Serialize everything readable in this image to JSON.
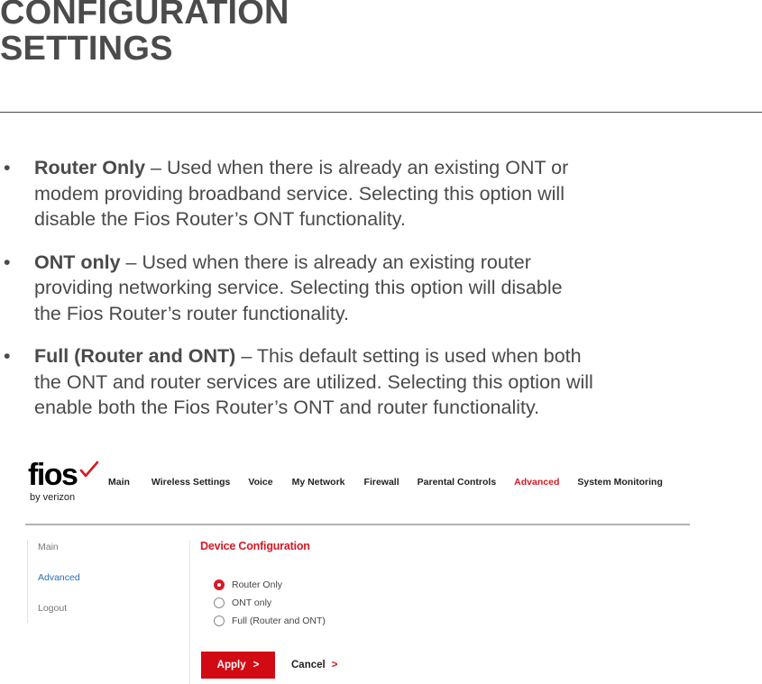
{
  "document": {
    "title_lines": [
      "CONFIGURATION",
      "SETTINGS"
    ],
    "bullet_glyph": "•",
    "bullets": [
      {
        "term": "Router Only",
        "lines": [
          " – Used when there is already an existing ONT or",
          "modem providing broadband service. Selecting this option will",
          "disable the Fios Router’s ONT functionality."
        ]
      },
      {
        "term": "ONT only",
        "lines": [
          " – Used when there is already an existing router",
          "providing networking service. Selecting this option will disable",
          "the Fios Router’s router functionality."
        ]
      },
      {
        "term": "Full (Router and ONT)",
        "lines": [
          " – This default setting is used when both",
          "the ONT and router services are utilized. Selecting this option will",
          "enable both the Fios Router’s ONT and router functionality."
        ]
      }
    ]
  },
  "router_ui": {
    "logo": {
      "brand": "fios",
      "sub": "by verizon",
      "check_icon": "checkmark-icon"
    },
    "top_nav": [
      {
        "label": "Main",
        "active": false
      },
      {
        "label": "Wireless Settings",
        "active": false
      },
      {
        "label": "Voice",
        "active": false
      },
      {
        "label": "My Network",
        "active": false
      },
      {
        "label": "Firewall",
        "active": false
      },
      {
        "label": "Parental Controls",
        "active": false
      },
      {
        "label": "Advanced",
        "active": true
      },
      {
        "label": "System Monitoring",
        "active": false
      }
    ],
    "side_nav": [
      {
        "label": "Main",
        "active": false
      },
      {
        "label": "Advanced",
        "active": true
      },
      {
        "label": "Logout",
        "active": false
      }
    ],
    "panel_title": "Device Configuration",
    "radio_options": [
      {
        "label": "Router Only",
        "checked": true
      },
      {
        "label": "ONT only",
        "checked": false
      },
      {
        "label": "Full (Router and ONT)",
        "checked": false
      }
    ],
    "apply_label": "Apply",
    "cancel_label": "Cancel",
    "chevron_glyph": ">"
  },
  "colors": {
    "accent_red": "#d51a24",
    "button_red": "#d10a14",
    "link_blue": "#2d6db5",
    "text_gray": "#4a4a4a"
  }
}
